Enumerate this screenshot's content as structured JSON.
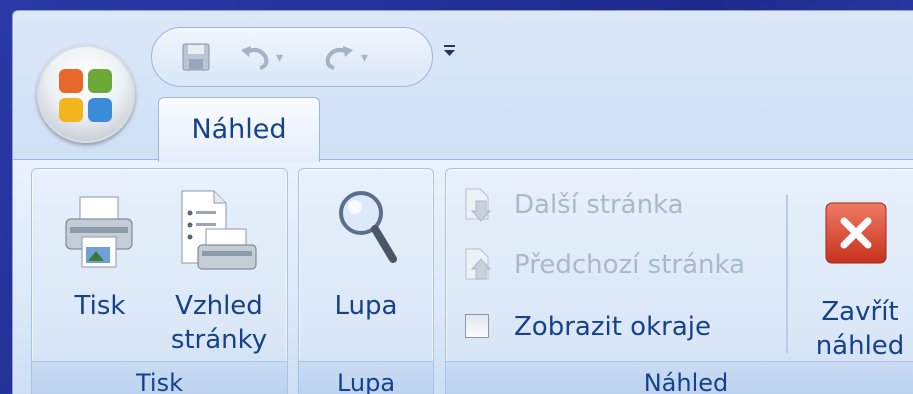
{
  "quick_access": {
    "save_icon": "save-icon",
    "undo_icon": "undo-icon",
    "redo_icon": "redo-icon",
    "customize_icon": "customize-qat-icon"
  },
  "office_button": {
    "icon": "office-logo-icon"
  },
  "tabs": [
    {
      "label": "Náhled",
      "selected": true
    }
  ],
  "groups": {
    "tisk": {
      "label": "Tisk",
      "print_label": "Tisk",
      "page_setup_label_1": "Vzhled",
      "page_setup_label_2": "stránky"
    },
    "lupa": {
      "label": "Lupa",
      "zoom_label": "Lupa"
    },
    "nahled": {
      "label": "Náhled",
      "next_page": "Další stránka",
      "prev_page": "Předchozí stránka",
      "show_margins": "Zobrazit okraje",
      "show_margins_checked": false,
      "close_label_1": "Zavřít",
      "close_label_2": "náhled"
    }
  },
  "colors": {
    "text": "#15428b",
    "disabled_text": "#a9b8cc",
    "close_red": "#d9452f"
  }
}
